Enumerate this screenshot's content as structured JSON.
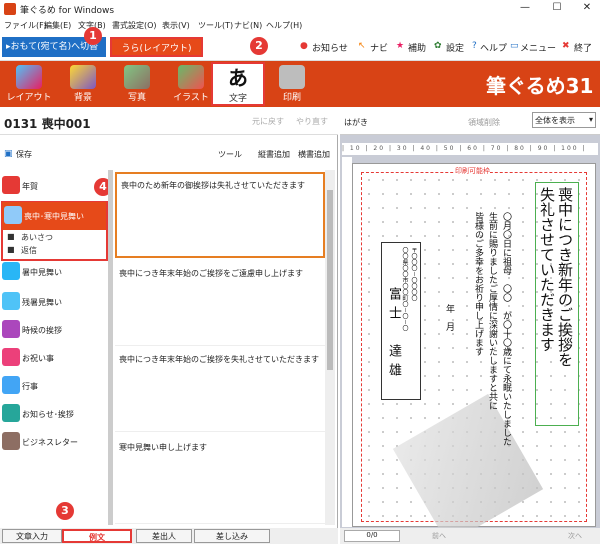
{
  "window": {
    "title": "筆ぐるめ for Windows",
    "min": "—",
    "max": "☐",
    "close": "✕"
  },
  "menu": [
    "ファイル(F)",
    "編集(E)",
    "文字(B)",
    "書式設定(O)",
    "表示(V)",
    "ツール(T)",
    "ナビ(N)",
    "ヘルプ(H)"
  ],
  "toggle": {
    "omote": "▸おもて(宛て名)へ切替",
    "ura": "うら(レイアウト)"
  },
  "toplinks": {
    "news": "お知らせ",
    "navi": "ナビ",
    "help_sub": "補助",
    "settings": "設定",
    "help": "ヘルプ",
    "menu": "メニュー",
    "exit": "終了"
  },
  "ribbon": {
    "layout": "レイアウト",
    "background": "背景",
    "photo": "写真",
    "illust": "イラスト",
    "text": "文字",
    "print": "印刷",
    "brand": "筆ぐるめ31",
    "text_glyph": "あ"
  },
  "badges": [
    "1",
    "2",
    "3",
    "4"
  ],
  "left": {
    "title": "0131 喪中001",
    "undo": "元に戻す",
    "redo": "やり直す",
    "save": "保存",
    "tool": "ツール",
    "vadd": "縦書追加",
    "hadd": "横書追加",
    "categories": [
      "年賀",
      "喪中･寒中見舞い",
      "暑中見舞い",
      "残暑見舞い",
      "時候の挨拶",
      "お祝い事",
      "行事",
      "お知らせ･挨拶",
      "ビジネスレター"
    ],
    "subitems": [
      "あいさつ",
      "返信"
    ],
    "examples": [
      "喪中のため新年の御挨拶は失礼させていただきます",
      "喪中につき年末年始のご挨拶をご遠慮申し上げます",
      "喪中につき年末年始のご挨拶を失礼させていただきます",
      "寒中見舞い申し上げます"
    ],
    "bottom": [
      "文章入力",
      "例文",
      "差出人",
      "差し込み"
    ]
  },
  "right": {
    "paper": "はがき",
    "field_delete": "領域削除",
    "zoom": "全体を表示",
    "printable": "印刷可能枠",
    "main_text": [
      "喪中につき新年のご挨拶を",
      "失礼させていただきます"
    ],
    "body_text": [
      "〇月〇日に祖母　〇〇　が〇十〇歳にて永眠いたしました",
      "生前に賜りましたご厚情に深謝いたしますと共に",
      "皆様のご多幸をお祈り申し上げます"
    ],
    "date": "年　月",
    "sender": {
      "zip": "〒〇〇〇－〇〇〇〇",
      "name": "富士　達雄",
      "address": "〇〇県〇〇市〇〇町〇－〇－〇"
    },
    "page": "0/0",
    "prev": "前へ",
    "next": "次へ"
  },
  "colors": {
    "accent": "#d84315",
    "blue": "#1f6fc5",
    "badge": "#e53935"
  }
}
